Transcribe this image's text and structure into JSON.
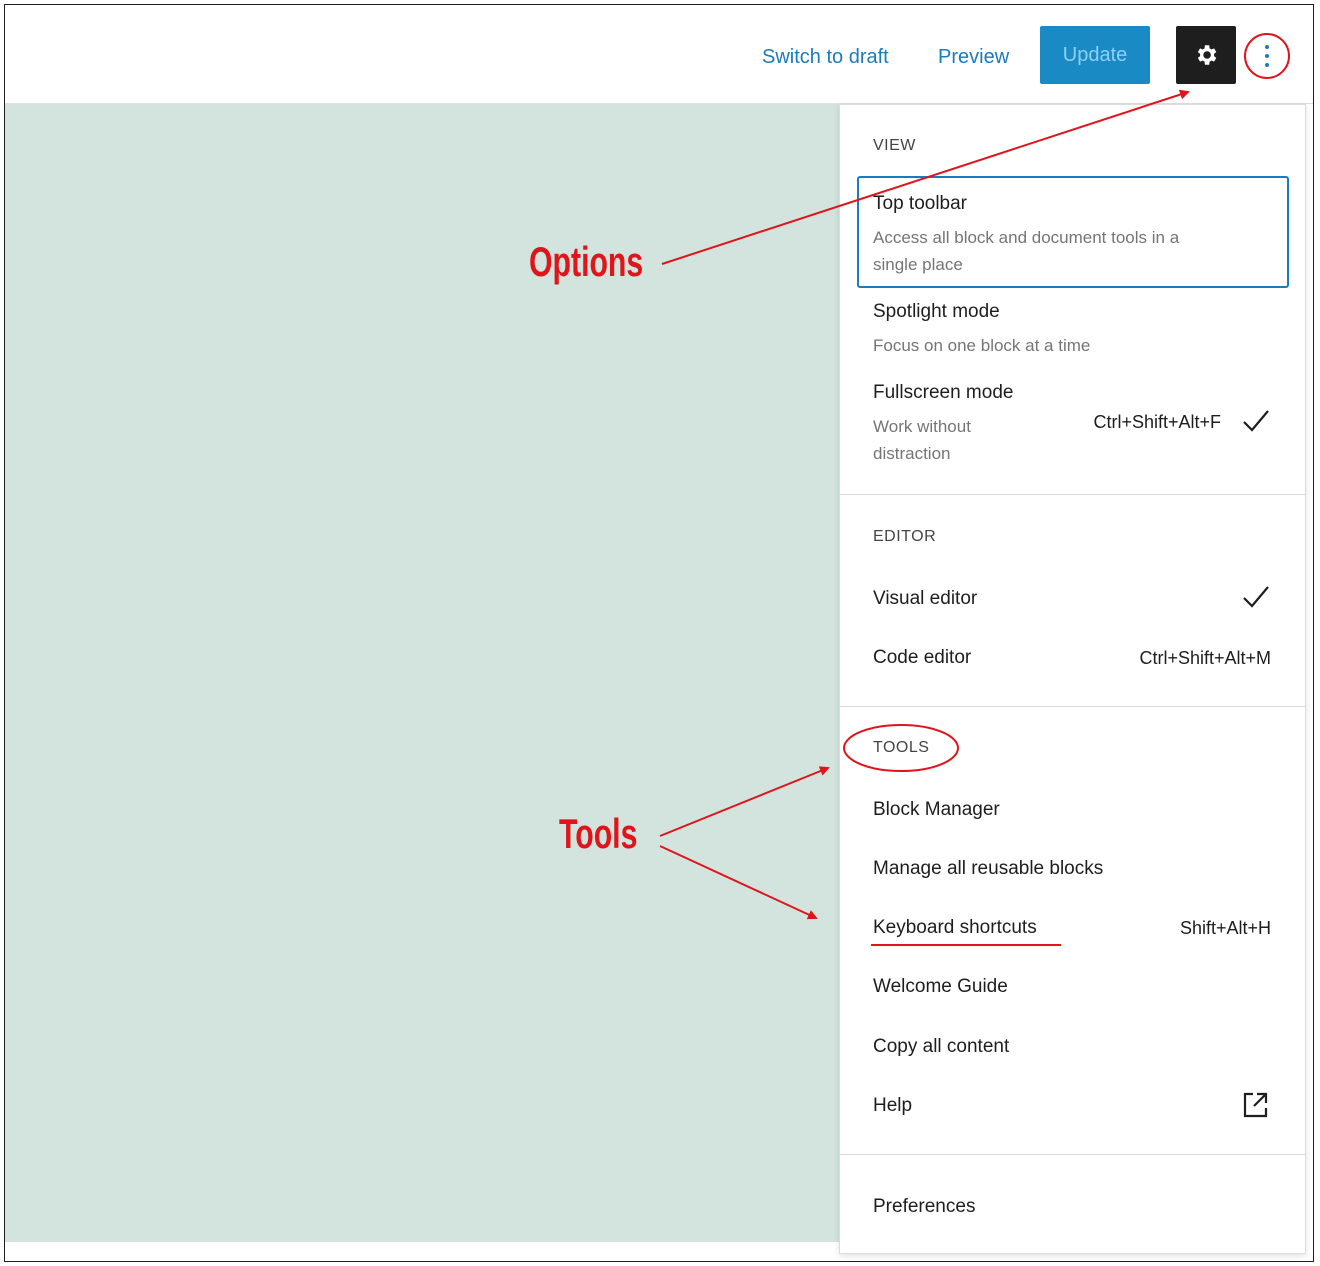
{
  "header": {
    "switch_to_draft": "Switch to draft",
    "preview": "Preview",
    "update": "Update",
    "settings_icon": "gear-icon",
    "options_icon": "kebab-vertical-icon"
  },
  "menu": {
    "view": {
      "label": "VIEW",
      "items": [
        {
          "title": "Top toolbar",
          "desc_line1": "Access all block and document tools in a",
          "desc_line2": "single place"
        },
        {
          "title": "Spotlight mode",
          "desc_line1": "Focus on one block at a time"
        },
        {
          "title": "Fullscreen mode",
          "desc_line1": "Work without",
          "desc_line2": "distraction",
          "shortcut": "Ctrl+Shift+Alt+F",
          "checked": true
        }
      ]
    },
    "editor": {
      "label": "EDITOR",
      "items": [
        {
          "title": "Visual editor",
          "checked": true
        },
        {
          "title": "Code editor",
          "shortcut": "Ctrl+Shift+Alt+M"
        }
      ]
    },
    "tools": {
      "label": "TOOLS",
      "items": [
        {
          "title": "Block Manager"
        },
        {
          "title": "Manage all reusable blocks"
        },
        {
          "title": "Keyboard shortcuts",
          "shortcut": "Shift+Alt+H"
        },
        {
          "title": "Welcome Guide"
        },
        {
          "title": "Copy all content"
        },
        {
          "title": "Help",
          "icon": "external-link-icon"
        }
      ]
    },
    "preferences": {
      "title": "Preferences"
    }
  },
  "annotations": {
    "options": "Options",
    "tools": "Tools",
    "color": "#e0141b"
  }
}
